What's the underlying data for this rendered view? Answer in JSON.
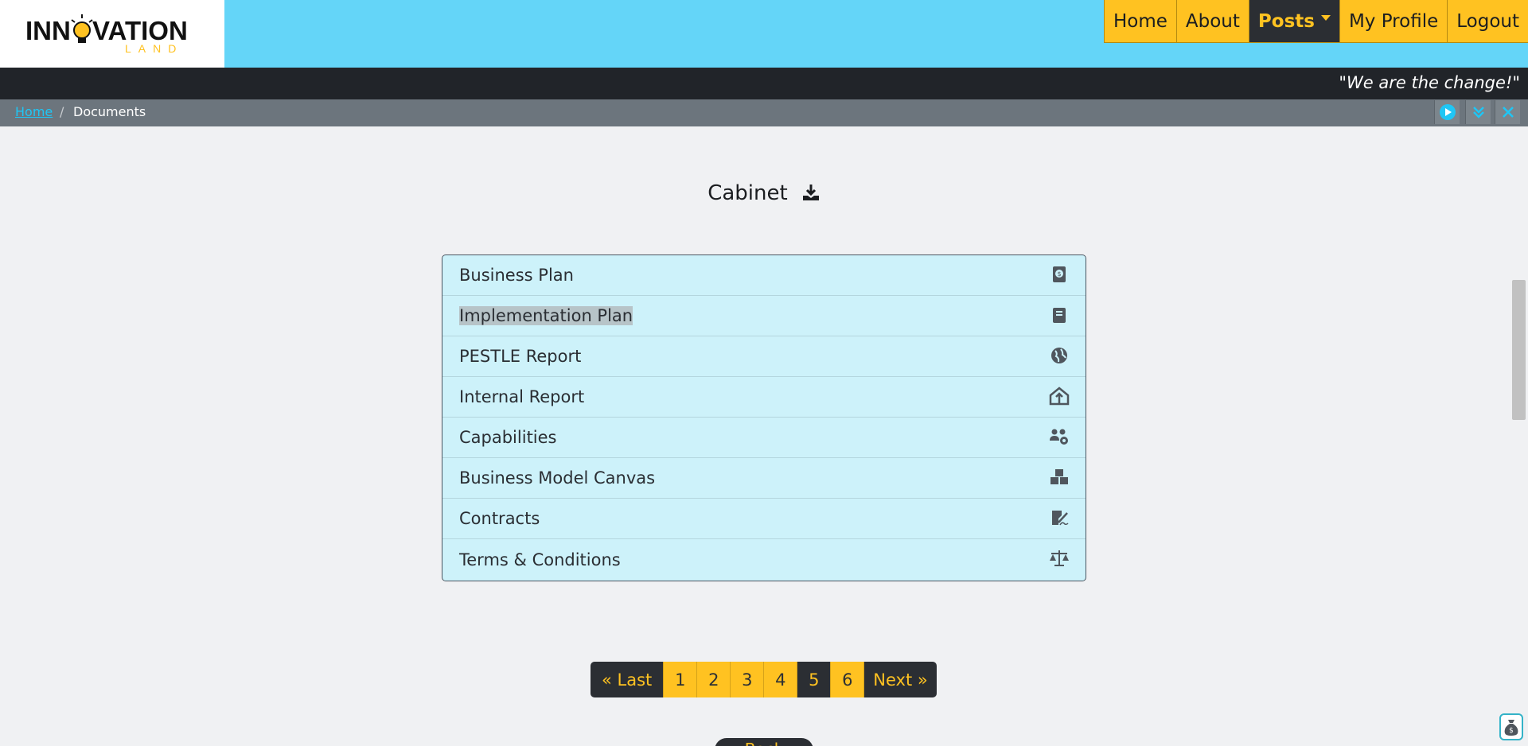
{
  "brand": {
    "logo_text": "INNOVATION",
    "logo_subtext": "LAND"
  },
  "nav": {
    "items": [
      {
        "label": "Home",
        "active": false
      },
      {
        "label": "About",
        "active": false
      },
      {
        "label": "Posts",
        "active": true,
        "dropdown": true
      },
      {
        "label": "My Profile",
        "active": false
      },
      {
        "label": "Logout",
        "active": false
      }
    ]
  },
  "tagline": "\"We are the change!\"",
  "breadcrumb": {
    "home": "Home",
    "separator": "/",
    "current": "Documents"
  },
  "page": {
    "title": "Cabinet"
  },
  "documents": [
    {
      "label": "Business Plan",
      "icon": "money-book-icon"
    },
    {
      "label": "Implementation Plan",
      "icon": "book-icon",
      "selected": true
    },
    {
      "label": "PESTLE Report",
      "icon": "globe-icon"
    },
    {
      "label": "Internal Report",
      "icon": "house-arrow-icon"
    },
    {
      "label": "Capabilities",
      "icon": "people-gear-icon"
    },
    {
      "label": "Business Model Canvas",
      "icon": "cubes-icon"
    },
    {
      "label": "Contracts",
      "icon": "signature-icon"
    },
    {
      "label": "Terms & Conditions",
      "icon": "scales-icon"
    }
  ],
  "pagination": {
    "first_label": "« Last",
    "pages": [
      "1",
      "2",
      "3",
      "4",
      "5",
      "6"
    ],
    "current_page": "5",
    "next_label": "Next »"
  },
  "bottom_button": {
    "label": "Back"
  },
  "colors": {
    "accent_yellow": "#ffc221",
    "header_blue": "#64d5f8",
    "dark": "#212429",
    "list_bg": "#cdf2fa"
  }
}
